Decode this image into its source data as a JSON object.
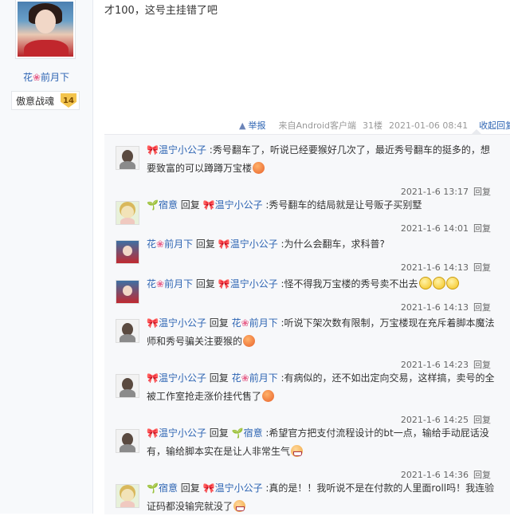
{
  "post": {
    "text": "才100，这号主挂错了吧",
    "author": {
      "name": "花",
      "name_suffix": "前月下",
      "flower": "❀",
      "badge_label": "傲意战魂",
      "badge_level": "14"
    },
    "meta": {
      "report": "举报",
      "client": "来自Android客户端",
      "floor": "31楼",
      "date": "2021-01-06 08:41",
      "collapse": "收起回复"
    }
  },
  "replies": [
    {
      "user_icon": "🎀",
      "user": "温宁小公子",
      "reply_to": "",
      "reply_to_icon": "",
      "content": ":秀号翻车了，听说已经要猴好几次了，最近秀号翻车的挺多的，想要致富的可以蹲蹲万宝楼",
      "emoji": [
        "orange"
      ],
      "time": "2021-1-6 13:17",
      "reply_label": "回复"
    },
    {
      "user_icon": "🌱",
      "user": "宿意",
      "reply_to": "温宁小公子",
      "reply_to_icon": "🎀",
      "content": ":秀号翻车的结局就是让号贩子买别墅",
      "emoji": [],
      "time": "2021-1-6 14:01",
      "reply_label": "回复"
    },
    {
      "user_icon": "❀",
      "user": "花前月下",
      "reply_to": "温宁小公子",
      "reply_to_icon": "🎀",
      "content": ":为什么会翻车，求科普?",
      "emoji": [],
      "time": "2021-1-6 14:13",
      "reply_label": "回复"
    },
    {
      "user_icon": "❀",
      "user": "花前月下",
      "reply_to": "温宁小公子",
      "reply_to_icon": "🎀",
      "content": ":怪不得我万宝楼的秀号卖不出去",
      "emoji": [
        "yellow",
        "yellow",
        "yellow"
      ],
      "time": "2021-1-6 14:13",
      "reply_label": "回复"
    },
    {
      "user_icon": "🎀",
      "user": "温宁小公子",
      "reply_to": "花前月下",
      "reply_to_icon": "❀",
      "content": ":听说下架次数有限制，万宝楼现在充斥着脚本魔法师和秀号骗关注要猴的",
      "emoji": [
        "orange"
      ],
      "time": "2021-1-6 14:23",
      "reply_label": "回复"
    },
    {
      "user_icon": "🎀",
      "user": "温宁小公子",
      "reply_to": "花前月下",
      "reply_to_icon": "❀",
      "content": ":有病似的，还不如出定向交易，这样搞，卖号的全被工作室抢走涨价挂代售了",
      "emoji": [
        "orange"
      ],
      "time": "2021-1-6 14:25",
      "reply_label": "回复"
    },
    {
      "user_icon": "🎀",
      "user": "温宁小公子",
      "reply_to": "宿意",
      "reply_to_icon": "🌱",
      "content": ":希望官方把支付流程设计的bt一点，输给手动屁话没有，输给脚本实在是让人非常生气",
      "emoji": [
        "grin"
      ],
      "time": "2021-1-6 14:36",
      "reply_label": "回复"
    },
    {
      "user_icon": "🌱",
      "user": "宿意",
      "reply_to": "温宁小公子",
      "reply_to_icon": "🎀",
      "content": ":真的是！！我听说不是在付款的人里面roll吗！我连验证码都没输完就没了",
      "emoji": [
        "grin"
      ],
      "time": "",
      "reply_label": ""
    }
  ],
  "reply_word": "回复"
}
